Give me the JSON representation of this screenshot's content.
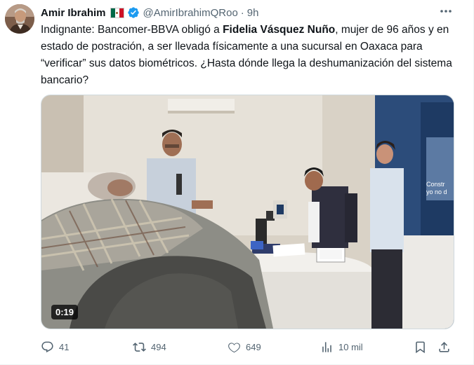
{
  "author": {
    "name": "Amir Ibrahim",
    "handle": "@AmirIbrahimQRoo",
    "separator": "·",
    "time": "9h",
    "flag_icon": "mexico-flag-icon",
    "verified_color": "#1d9bf0"
  },
  "tweet": {
    "text_1": "Indignante: Bancomer-BBVA obligó a ",
    "text_bold": "Fidelia Vásquez Nuño",
    "text_2": ", mujer de 96 años y en estado de postración, a ser llevada físicamente a una sucursal en Oaxaca para “verificar” sus datos biométricos. ¿Hasta dónde llega la deshumanización del sistema bancario?"
  },
  "media": {
    "duration": "0:19",
    "sign_text_1": "Constr",
    "sign_text_2": "yo no d"
  },
  "actions": {
    "replies": "41",
    "reposts": "494",
    "likes": "649",
    "views": "10 mil"
  },
  "colors": {
    "text": "#0f1419",
    "secondary": "#536471",
    "accent": "#1d9bf0"
  }
}
